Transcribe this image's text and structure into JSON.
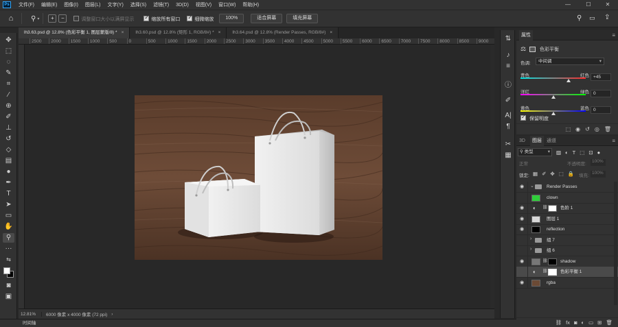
{
  "app": {
    "logo": "Ps"
  },
  "menu": [
    "文件(F)",
    "编辑(E)",
    "图像(I)",
    "图层(L)",
    "文字(Y)",
    "选择(S)",
    "滤镜(T)",
    "3D(D)",
    "视图(V)",
    "窗口(W)",
    "帮助(H)"
  ],
  "window_controls": {
    "minimize": "—",
    "maximize": "☐",
    "close": "✕"
  },
  "options_bar": {
    "resize_windows_label": "调整窗口大小以满屏显示",
    "zoom_all_label": "缩放所有窗口",
    "scrubby_zoom_label": "细微缩放",
    "zoom_value": "100%",
    "fit_screen_label": "适合屏幕",
    "fill_screen_label": "填充屏幕"
  },
  "tabs": [
    {
      "label": "lh3.63.psd @ 12.8% (色彩平衡 1, 图层蒙版/8) *",
      "active": true
    },
    {
      "label": "lh3.60.psd @ 12.8% (矩形 1, RGB/8#) *",
      "active": false
    },
    {
      "label": "lh3.64.psd @ 12.8% (Render Passes, RGB/8#)",
      "active": false
    }
  ],
  "ruler_ticks": [
    "2500",
    "2000",
    "1500",
    "1000",
    "500",
    "0",
    "500",
    "1000",
    "1500",
    "2000",
    "2500",
    "3000",
    "3500",
    "4000",
    "4500",
    "5000",
    "5500",
    "6000",
    "6500",
    "7000",
    "7500",
    "8000",
    "8500",
    "9000",
    "95"
  ],
  "status": {
    "zoom": "12.81%",
    "doc_info": "6000 像素 x 4000 像素 (72 ppi)"
  },
  "timeline_label": "时间轴",
  "properties": {
    "panel_title": "属性",
    "adjustment_title": "色彩平衡",
    "tone_label": "色调:",
    "tone_value": "中间调",
    "sliders": [
      {
        "left": "青色",
        "right": "红色",
        "value": "+45",
        "position": 0.74
      },
      {
        "left": "洋红",
        "right": "绿色",
        "value": "0",
        "position": 0.5
      },
      {
        "left": "黄色",
        "right": "蓝色",
        "value": "0",
        "position": 0.5
      }
    ],
    "preserve_luminosity_label": "保留明度"
  },
  "layers_panel": {
    "tabs": [
      "3D",
      "图层",
      "通道"
    ],
    "filter_label": "类型",
    "blend_mode": "正常",
    "opacity_label": "不透明度:",
    "opacity_value": "100%",
    "lock_label": "锁定:",
    "fill_label": "填充:",
    "fill_value": "100%",
    "layers": [
      {
        "name": "Render Passes",
        "kind": "group",
        "visible": true,
        "expanded": true
      },
      {
        "name": "clown",
        "kind": "pixel",
        "visible": false,
        "thumb_color": "#2fcf3a"
      },
      {
        "name": "色阶 1",
        "kind": "adjustment",
        "visible": true
      },
      {
        "name": "图层 1",
        "kind": "pixel",
        "visible": true,
        "thumb_color": "#d8d8d8"
      },
      {
        "name": "reflection",
        "kind": "pixel",
        "visible": true,
        "thumb_color": "#000000"
      },
      {
        "name": "组 7",
        "kind": "group",
        "visible": false,
        "expanded": false
      },
      {
        "name": "组 6",
        "kind": "group",
        "visible": false,
        "expanded": false
      },
      {
        "name": "shadow",
        "kind": "masked",
        "visible": true
      },
      {
        "name": "色彩平衡 1",
        "kind": "adjustment",
        "visible": false,
        "selected": true
      },
      {
        "name": "rgba",
        "kind": "pixel",
        "visible": true,
        "thumb_color": "#6b4a35"
      }
    ]
  },
  "colors": {
    "bg": "#282828",
    "panel": "#323232",
    "accent": "#31a8ff",
    "wood_dark": "#4a3122",
    "wood_light": "#7a5a45",
    "bag": "#e9e9e9"
  }
}
